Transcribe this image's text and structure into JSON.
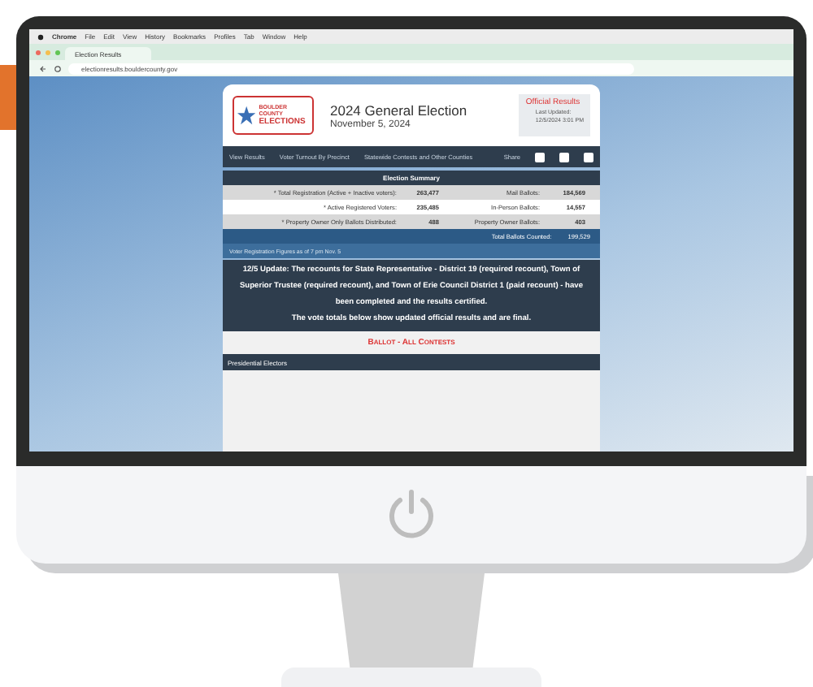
{
  "browser": {
    "menu_bar": {
      "app": "Chrome",
      "items": [
        "File",
        "Edit",
        "View",
        "History",
        "Bookmarks",
        "Profiles",
        "Tab",
        "Window",
        "Help"
      ]
    },
    "tab": "Election Results",
    "address": "electionresults.bouldercounty.gov"
  },
  "page": {
    "logo": {
      "line1": "BOULDER COUNTY",
      "line2": "ELECTIONS"
    },
    "title": "2024 General Election",
    "date": "November 5, 2024",
    "status": "Official Results",
    "updated_label": "Last Updated:",
    "updated": "12/5/2024 3:01 PM",
    "nav": [
      "View Results",
      "Voter Turnout By Precinct",
      "Statewide Contests and Other Counties"
    ],
    "share": "Share",
    "summary": {
      "title": "Election Summary",
      "rows": [
        {
          "label": "* Total Registration (Active + Inactive voters):",
          "value": "263,477",
          "label2": "Mail Ballots:",
          "value2": "184,569"
        },
        {
          "label": "* Active Registered Voters:",
          "value": "235,485",
          "label2": "In-Person Ballots:",
          "value2": "14,557"
        },
        {
          "label": "* Property Owner Only Ballots Distributed:",
          "value": "488",
          "label2": "Property Owner Ballots:",
          "value2": "403"
        }
      ],
      "total_label": "Total Ballots Counted:",
      "total": "199,529",
      "note": "Voter Registration Figures as of 7 pm Nov. 5"
    },
    "notice": [
      "12/5 Update: The recounts for State Representative - District 19 (required recount), Town of Superior Trustee (required recount), and Town of Erie Council District 1 (paid recount) - have been completed and the results certified.",
      "The vote totals below show updated official results and are final."
    ],
    "section_title": "Ballot - All Contests",
    "contest": "Presidential Electors"
  }
}
